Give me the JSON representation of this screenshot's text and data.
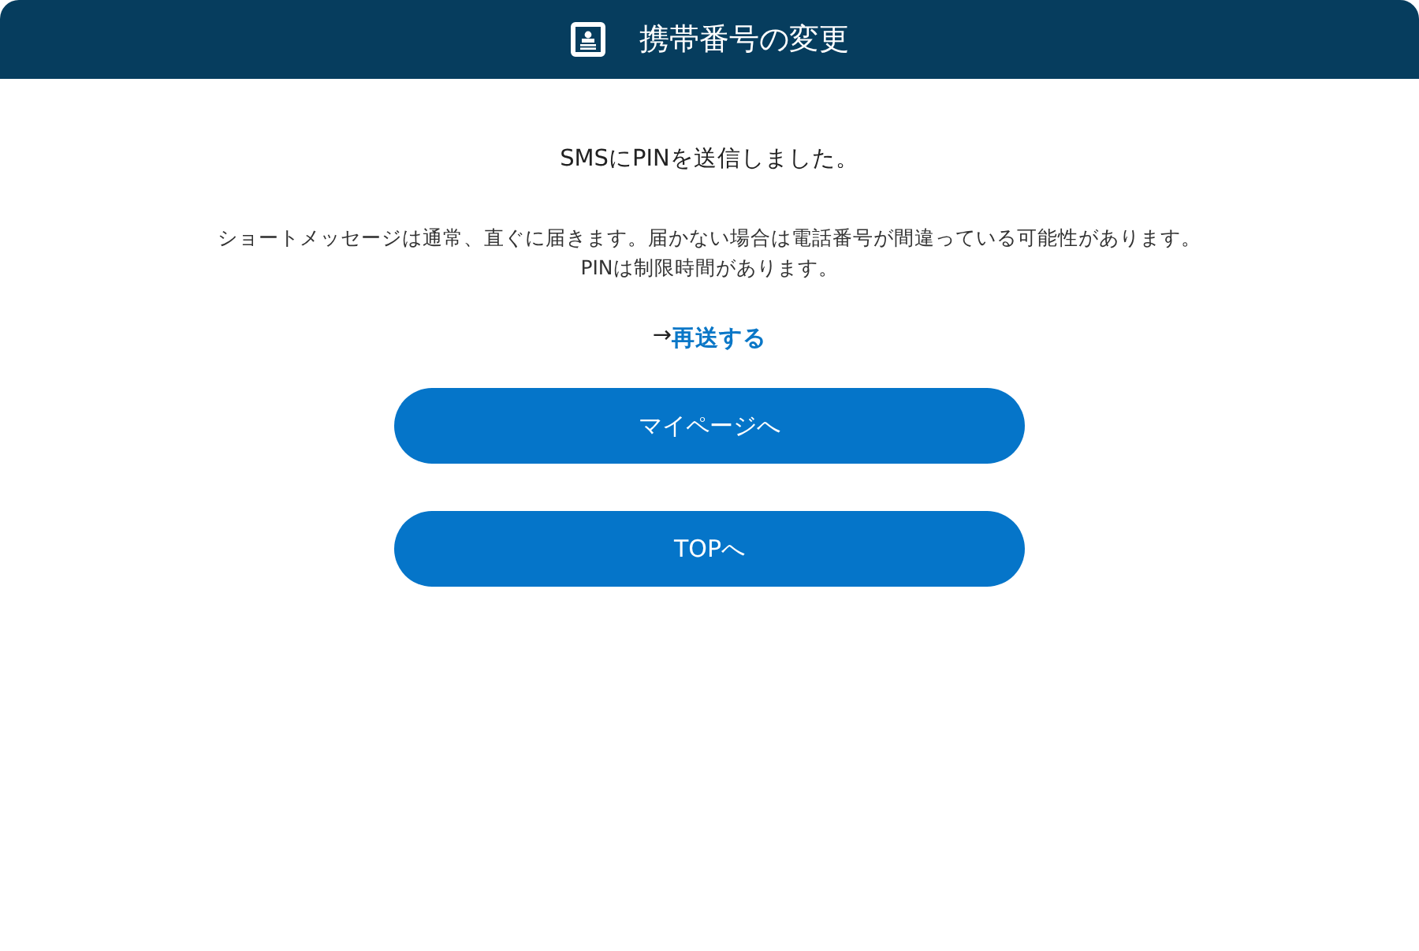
{
  "header": {
    "title": "携帯番号の変更"
  },
  "heading": "SMSにPINを送信しました。",
  "description": [
    "ショートメッセージは通常、直ぐに届きます。届かない場合は電話番号が間違っている可能性があります。",
    "PINは制限時間があります。"
  ],
  "resend": {
    "arrow": "→",
    "link": "再送する"
  },
  "buttons": [
    "マイページへ",
    "TOPへ"
  ]
}
